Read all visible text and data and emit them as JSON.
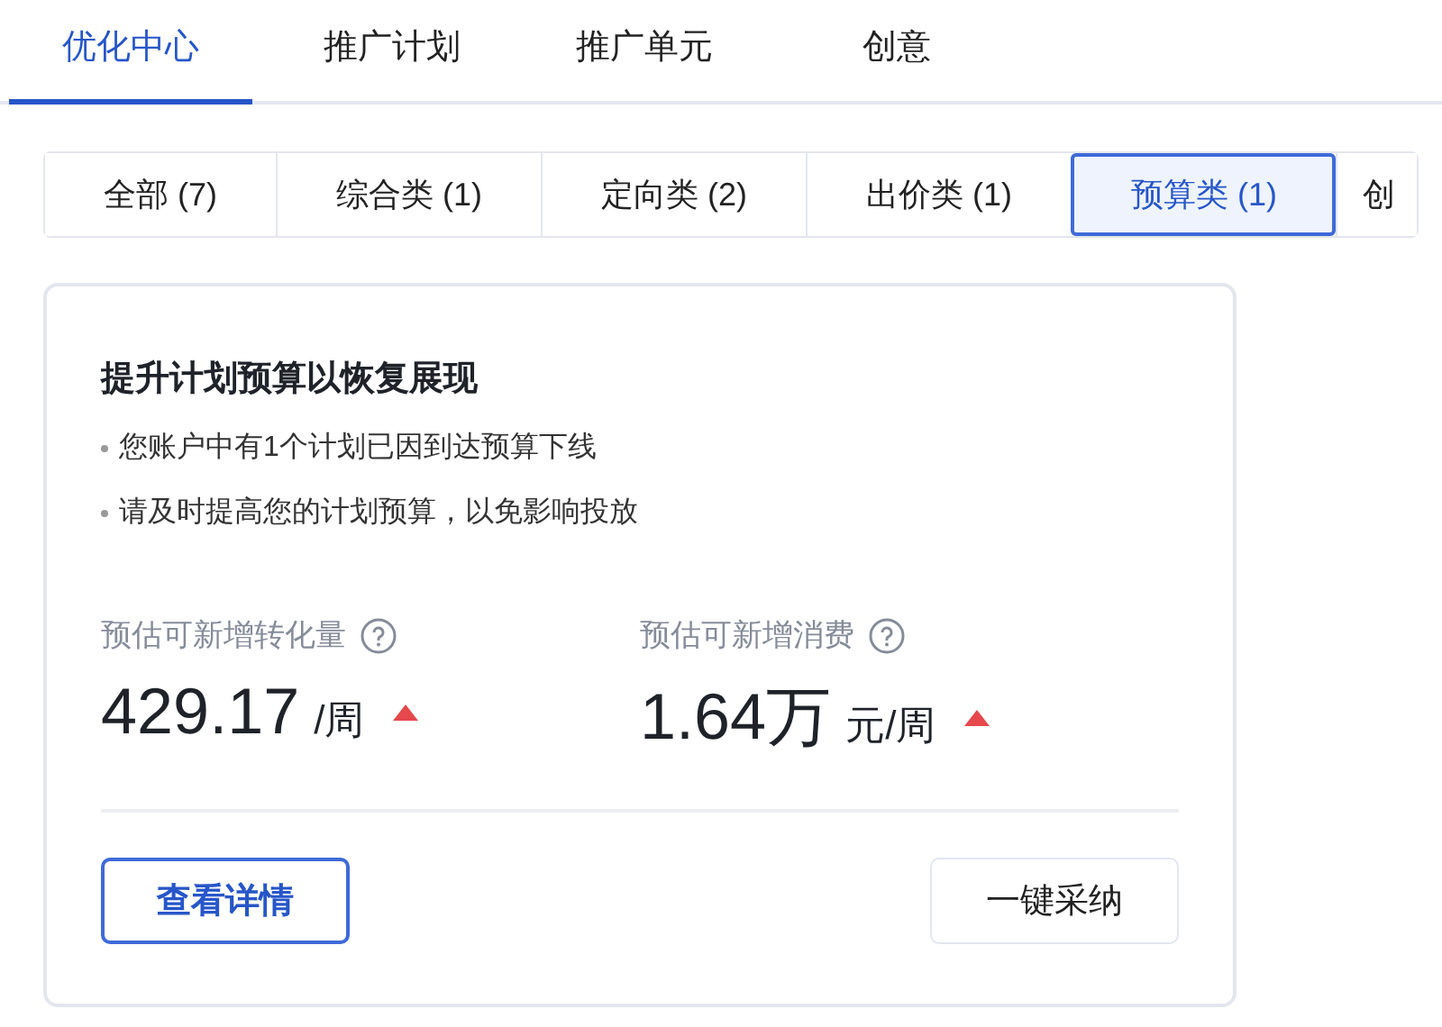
{
  "tabs": [
    {
      "label": "优化中心",
      "selected": true
    },
    {
      "label": "推广计划",
      "selected": false
    },
    {
      "label": "推广单元",
      "selected": false
    },
    {
      "label": "创意",
      "selected": false
    }
  ],
  "filters": [
    {
      "label": "全部 (7)",
      "selected": false
    },
    {
      "label": "综合类 (1)",
      "selected": false
    },
    {
      "label": "定向类 (2)",
      "selected": false
    },
    {
      "label": "出价类 (1)",
      "selected": false
    },
    {
      "label": "预算类 (1)",
      "selected": true
    },
    {
      "label": "创",
      "selected": false
    }
  ],
  "card": {
    "title": "提升计划预算以恢复展现",
    "bullets": [
      "您账户中有1个计划已因到达预算下线",
      "请及时提高您的计划预算，以免影响投放"
    ],
    "metrics": [
      {
        "label": "预估可新增转化量",
        "value": "429.17",
        "unit": "/周",
        "rising": true
      },
      {
        "label": "预估可新增消费",
        "value": "1.64万",
        "unit": "元/周",
        "rising": true
      }
    ],
    "buttons": [
      {
        "label": "查看详情",
        "kind": "primary"
      },
      {
        "label": "一键采纳",
        "kind": "default"
      }
    ]
  }
}
